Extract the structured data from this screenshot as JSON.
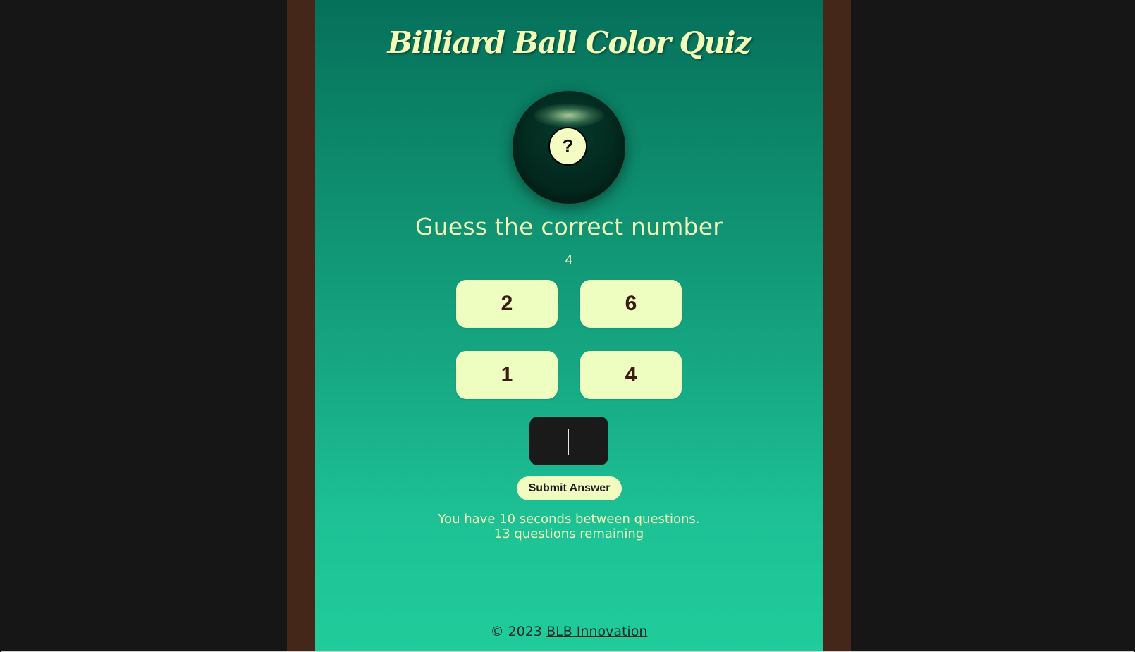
{
  "header": {
    "title": "Billiard Ball Color Quiz"
  },
  "ball": {
    "badge_text": "?",
    "ball_color": "#03291e",
    "badge_color": "#f4fcc4"
  },
  "quiz": {
    "prompt": "Guess the correct number",
    "hint_number": "4",
    "choices": [
      "2",
      "6",
      "1",
      "4"
    ],
    "answer_value": "",
    "submit_label": "Submit Answer",
    "timer_text": "You have 10 seconds between questions.",
    "remaining_text": "13 questions remaining"
  },
  "footer": {
    "copyright": "© 2023",
    "link_text": "BLB Innovation"
  },
  "colors": {
    "background": "#161616",
    "rail": "#45271a",
    "felt_top": "#06705a",
    "felt_bottom": "#20cc9b",
    "accent": "#eefdc0"
  }
}
